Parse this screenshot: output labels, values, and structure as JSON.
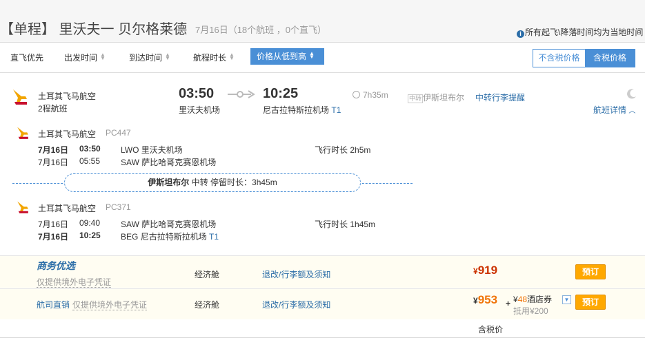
{
  "header": {
    "route": "【单程】 里沃夫一 贝尔格莱德",
    "subtitle": "7月16日（18个航班 ，0个直飞）",
    "time_note": "所有起飞\\降落时间均为当地时间"
  },
  "sort_bar": {
    "direct_first": "直飞优先",
    "departure_time": "出发时间",
    "arrival_time": "到达时间",
    "duration": "航程时长",
    "price_low_high": "价格从低到高",
    "tax_excluded": "不含税价格",
    "tax_included": "含税价格"
  },
  "flight": {
    "airline": "土耳其飞马航空",
    "trip_type": "2程航班",
    "depart_time": "03:50",
    "depart_airport": "里沃夫机场",
    "arrive_time": "10:25",
    "arrive_airport": "尼古拉特斯拉机场",
    "arrive_terminal": "T1",
    "duration": "7h35m",
    "transfer_city": "伊斯坦布尔",
    "transfer_tag": "中转",
    "baggage_reminder": "中转行李提醒",
    "details_link": "航班详情"
  },
  "legs": [
    {
      "airline": "土耳其飞马航空",
      "flight_no": "PC447",
      "dep_date": "7月16日",
      "dep_time": "03:50",
      "dep_code": "LWO",
      "dep_airport": "里沃夫机场",
      "arr_date": "7月16日",
      "arr_time": "05:55",
      "arr_code": "SAW",
      "arr_airport": "萨比哈哥克赛恩机场",
      "duration_label": "飞行时长",
      "duration": "2h5m"
    },
    {
      "airline": "土耳其飞马航空",
      "flight_no": "PC371",
      "dep_date": "7月16日",
      "dep_time": "09:40",
      "dep_code": "SAW",
      "dep_airport": "萨比哈哥克赛恩机场",
      "arr_date": "7月16日",
      "arr_time": "10:25",
      "arr_code": "BEG",
      "arr_airport": "尼古拉特斯拉机场",
      "arr_terminal": "T1",
      "duration_label": "飞行时长",
      "duration": "1h45m"
    }
  ],
  "transfer": {
    "city": "伊斯坦布尔",
    "label": "中转",
    "stay_label": "停留时长：",
    "stay": "3h45m"
  },
  "offers": [
    {
      "vendor": "商务优选",
      "voucher": "仅提供境外电子凭证",
      "cabin": "经济舱",
      "policy": "退改/行李额及须知",
      "currency": "¥",
      "price": "919",
      "book": "预订"
    },
    {
      "vendor": "航司直销",
      "voucher": "仅提供境外电子凭证",
      "cabin": "经济舱",
      "policy": "退改/行李额及须知",
      "currency": "¥",
      "price": "953",
      "plus": "+",
      "coupon_currency": "¥",
      "coupon_amount": "48",
      "coupon_label": "酒店券",
      "deduct": "抵用¥200",
      "book": "预订"
    }
  ],
  "footer": {
    "tax_note": "含税价"
  },
  "colors": {
    "accent": "#4a8fd6",
    "link": "#2c6ea8",
    "price": "#cc3300",
    "book": "#ffa800"
  }
}
